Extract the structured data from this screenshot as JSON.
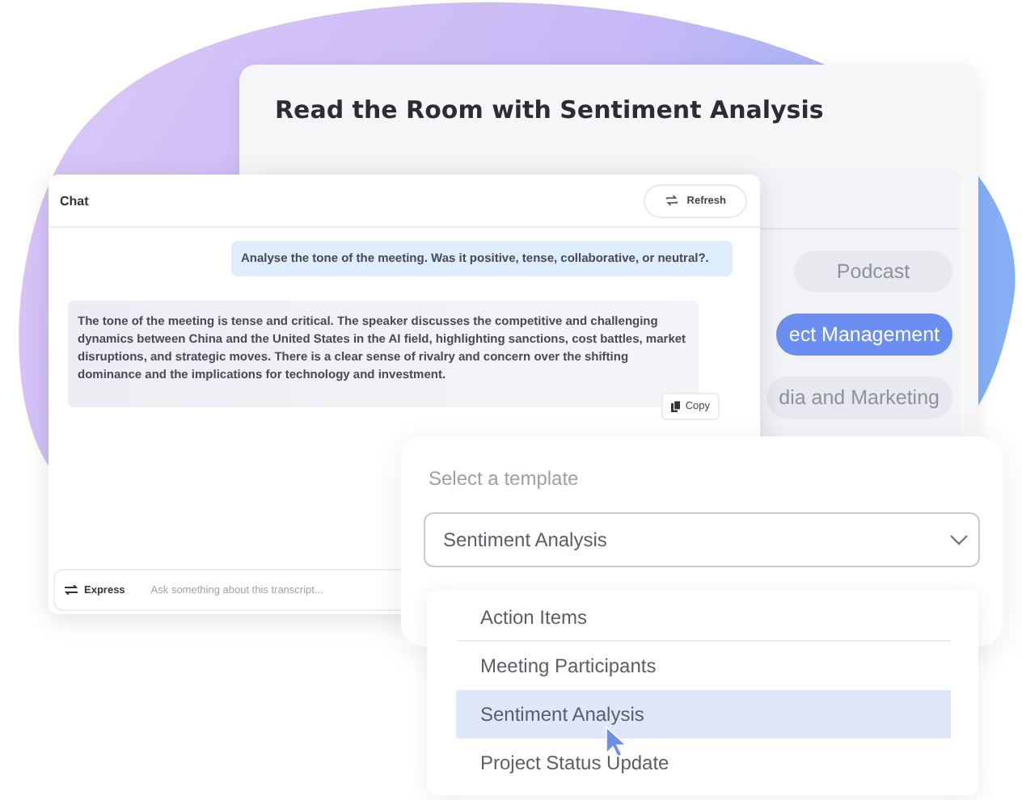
{
  "back_card": {
    "title": "Read the Room with Sentiment Analysis",
    "chips": [
      {
        "label": "Podcast",
        "selected": false
      },
      {
        "label": "ect Management",
        "selected": true
      },
      {
        "label": "dia and Marketing",
        "selected": false
      }
    ]
  },
  "chat": {
    "title": "Chat",
    "refresh_button": "Refresh",
    "messages": [
      {
        "kind": "user",
        "text": "Analyse the tone of the meeting. Was it positive, tense, collaborative, or neutral?."
      },
      {
        "kind": "assistant",
        "text": "The tone of the meeting is tense and critical. The speaker discusses the competitive and challenging dynamics between China and the United States in the AI field, highlighting sanctions, cost battles, market disruptions, and strategic moves. There is a clear sense of rivalry and concern over the shifting dominance and the implications for technology and investment.",
        "copy_button": "Copy"
      }
    ],
    "mode_button": "Express",
    "input": {
      "placeholder": "Ask something about this transcript..."
    }
  },
  "template_picker": {
    "label": "Select a template",
    "value": "Sentiment Analysis",
    "options": [
      {
        "label": "Action Items",
        "selected": false
      },
      {
        "label": "Meeting Participants",
        "selected": false
      },
      {
        "label": "Sentiment Analysis",
        "selected": true
      },
      {
        "label": "Project Status Update",
        "selected": false
      }
    ]
  }
}
